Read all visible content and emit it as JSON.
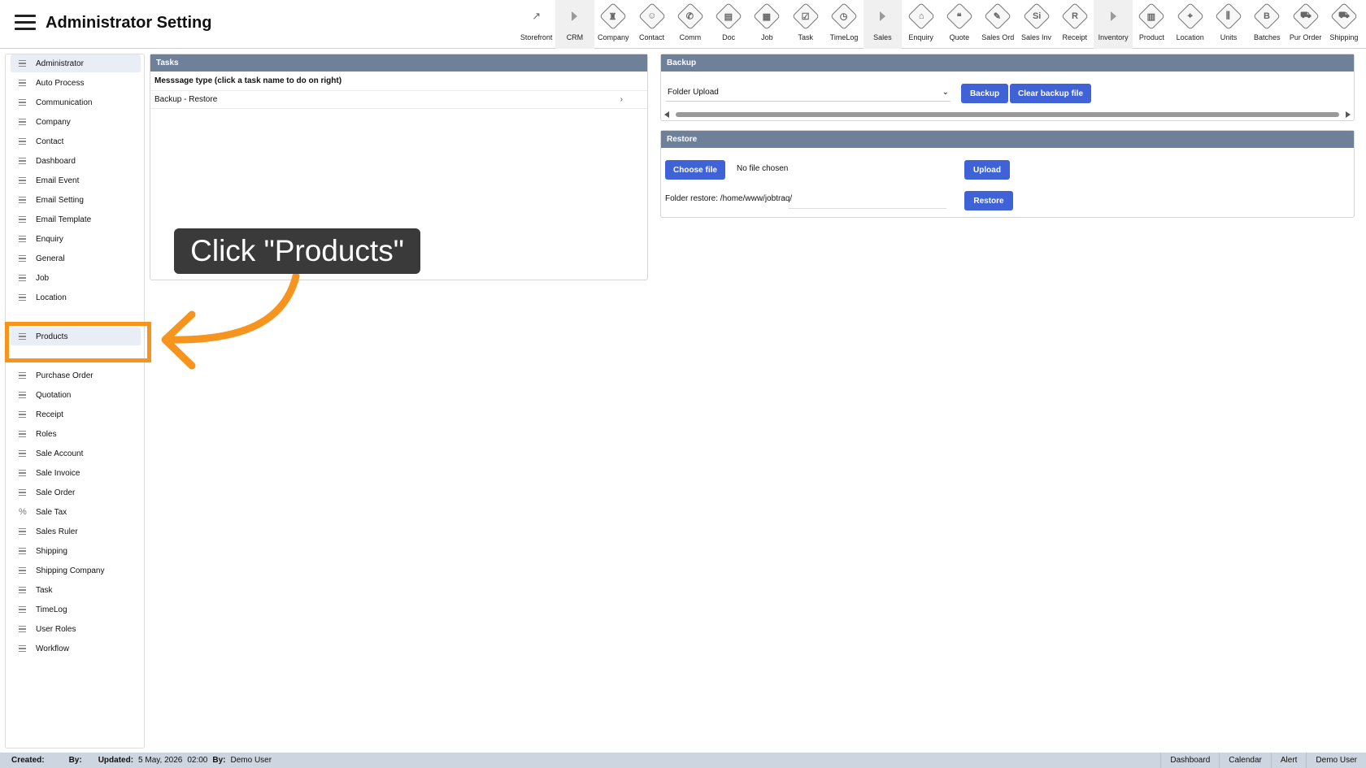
{
  "header": {
    "title": "Administrator Setting",
    "toolbar": [
      {
        "label": "Storefront",
        "icon": "external-link-icon",
        "kind": "plain",
        "glyph": "↗"
      },
      {
        "label": "CRM",
        "icon": "triangle-right-icon",
        "kind": "sep",
        "glyph": ""
      },
      {
        "label": "Company",
        "icon": "company-icon",
        "kind": "diamond",
        "glyph": "♜"
      },
      {
        "label": "Contact",
        "icon": "contact-icon",
        "kind": "diamond",
        "glyph": "☺"
      },
      {
        "label": "Comm",
        "icon": "comm-icon",
        "kind": "diamond",
        "glyph": "✆"
      },
      {
        "label": "Doc",
        "icon": "doc-icon",
        "kind": "diamond",
        "glyph": "▤"
      },
      {
        "label": "Job",
        "icon": "job-icon",
        "kind": "diamond",
        "glyph": "▦"
      },
      {
        "label": "Task",
        "icon": "task-icon",
        "kind": "diamond",
        "glyph": "☑"
      },
      {
        "label": "TimeLog",
        "icon": "clock-icon",
        "kind": "diamond",
        "glyph": "◷"
      },
      {
        "label": "Sales",
        "icon": "triangle-right-icon",
        "kind": "sep",
        "glyph": ""
      },
      {
        "label": "Enquiry",
        "icon": "enquiry-icon",
        "kind": "diamond",
        "glyph": "⌂"
      },
      {
        "label": "Quote",
        "icon": "quote-icon",
        "kind": "diamond",
        "glyph": "❝"
      },
      {
        "label": "Sales Ord",
        "icon": "sales-order-icon",
        "kind": "diamond",
        "glyph": "✎"
      },
      {
        "label": "Sales Inv",
        "icon": "sales-invoice-icon",
        "kind": "diamond",
        "glyph": "Si"
      },
      {
        "label": "Receipt",
        "icon": "receipt-icon",
        "kind": "diamond",
        "glyph": "R"
      },
      {
        "label": "Inventory",
        "icon": "triangle-right-icon",
        "kind": "sep",
        "glyph": ""
      },
      {
        "label": "Product",
        "icon": "product-icon",
        "kind": "diamond",
        "glyph": "▥"
      },
      {
        "label": "Location",
        "icon": "location-icon",
        "kind": "diamond",
        "glyph": "⌖"
      },
      {
        "label": "Units",
        "icon": "units-icon",
        "kind": "diamond",
        "glyph": "⫼"
      },
      {
        "label": "Batches",
        "icon": "batches-icon",
        "kind": "diamond",
        "glyph": "B"
      },
      {
        "label": "Pur Order",
        "icon": "cart-icon",
        "kind": "diamond",
        "glyph": "⛟"
      },
      {
        "label": "Shipping",
        "icon": "truck-icon",
        "kind": "diamond",
        "glyph": "⛟"
      }
    ]
  },
  "sidebar": {
    "items": [
      {
        "label": "Administrator",
        "icon": "list-icon",
        "active": true
      },
      {
        "label": "Auto Process",
        "icon": "list-icon"
      },
      {
        "label": "Communication",
        "icon": "list-icon"
      },
      {
        "label": "Company",
        "icon": "list-icon"
      },
      {
        "label": "Contact",
        "icon": "list-icon"
      },
      {
        "label": "Dashboard",
        "icon": "list-icon"
      },
      {
        "label": "Email Event",
        "icon": "list-icon"
      },
      {
        "label": "Email Setting",
        "icon": "list-icon"
      },
      {
        "label": "Email Template",
        "icon": "list-icon"
      },
      {
        "label": "Enquiry",
        "icon": "list-icon"
      },
      {
        "label": "General",
        "icon": "list-icon"
      },
      {
        "label": "Job",
        "icon": "list-icon"
      },
      {
        "label": "Location",
        "icon": "list-icon"
      },
      {
        "label": "Products",
        "icon": "list-icon",
        "active": true
      },
      {
        "label": "Purchase Order",
        "icon": "list-icon"
      },
      {
        "label": "Quotation",
        "icon": "list-icon"
      },
      {
        "label": "Receipt",
        "icon": "list-icon"
      },
      {
        "label": "Roles",
        "icon": "list-icon"
      },
      {
        "label": "Sale Account",
        "icon": "list-icon"
      },
      {
        "label": "Sale Invoice",
        "icon": "list-icon"
      },
      {
        "label": "Sale Order",
        "icon": "list-icon"
      },
      {
        "label": "Sale Tax",
        "icon": "percent-icon"
      },
      {
        "label": "Sales Ruler",
        "icon": "list-icon"
      },
      {
        "label": "Shipping",
        "icon": "list-icon"
      },
      {
        "label": "Shipping Company",
        "icon": "list-icon"
      },
      {
        "label": "Task",
        "icon": "list-icon"
      },
      {
        "label": "TimeLog",
        "icon": "list-icon"
      },
      {
        "label": "User Roles",
        "icon": "list-icon"
      },
      {
        "label": "Workflow",
        "icon": "list-icon"
      }
    ]
  },
  "tasks": {
    "title": "Tasks",
    "header": "Messsage type (click a task name to do on right)",
    "rows": [
      {
        "label": "Backup - Restore",
        "chevron": "›"
      }
    ]
  },
  "backup": {
    "title": "Backup",
    "select_value": "Folder Upload",
    "backup_label": "Backup",
    "clear_label": "Clear backup file"
  },
  "restore": {
    "title": "Restore",
    "choose_label": "Choose file",
    "no_file": "No file chosen",
    "upload_label": "Upload",
    "folder_restore": "Folder restore: /home/www/jobtraq/",
    "restore_label": "Restore"
  },
  "tutorial": {
    "callout": "Click \"Products\"",
    "accent": "#f7941d"
  },
  "footer": {
    "created_label": "Created:",
    "by_label": "By:",
    "updated_label": "Updated:",
    "updated_value": "5 May, 2026",
    "time": "02:00",
    "by2_label": "By:",
    "by2_value": "Demo User",
    "links": [
      "Dashboard",
      "Calendar",
      "Alert",
      "Demo User"
    ]
  }
}
